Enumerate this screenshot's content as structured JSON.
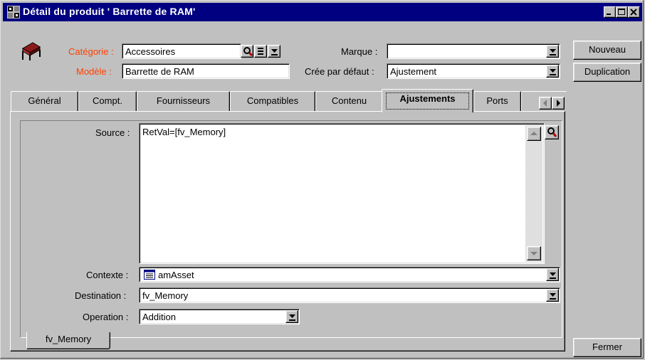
{
  "window": {
    "title": "Détail du produit ' Barrette de RAM'"
  },
  "header": {
    "categorie_label": "Catégorie :",
    "categorie_value": "Accessoires",
    "modele_label": "Modèle :",
    "modele_value": "Barrette de RAM",
    "marque_label": "Marque :",
    "marque_value": "",
    "cree_label": "Crée par défaut :",
    "cree_value": "Ajustement"
  },
  "buttons": {
    "nouveau": "Nouveau",
    "duplication": "Duplication",
    "fermer": "Fermer"
  },
  "tabs": [
    {
      "label": "Général"
    },
    {
      "label": "Compt."
    },
    {
      "label": "Fournisseurs"
    },
    {
      "label": "Compatibles"
    },
    {
      "label": "Contenu"
    },
    {
      "label": "Ajustements"
    },
    {
      "label": "Ports"
    }
  ],
  "active_tab": "Ajustements",
  "ajustements": {
    "source_label": "Source :",
    "source_value": "RetVal=[fv_Memory]",
    "contexte_label": "Contexte :",
    "contexte_value": "amAsset",
    "destination_label": "Destination :",
    "destination_value": "fv_Memory",
    "operation_label": "Operation :",
    "operation_value": "Addition"
  },
  "subtabs": [
    {
      "label": "fv_Memory"
    }
  ],
  "colors": {
    "titlebar": "#000080",
    "required_label": "#ff4000",
    "face": "#c0c0c0"
  }
}
